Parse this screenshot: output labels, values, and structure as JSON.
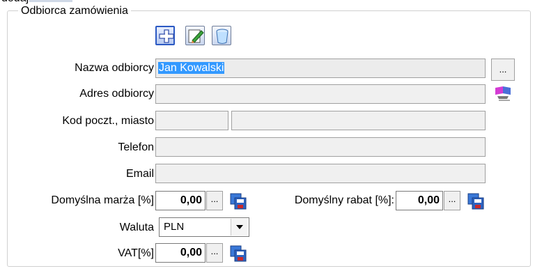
{
  "top_clipped_text": "dodaj",
  "group": {
    "title": "Odbiorca zamówienia"
  },
  "toolbar": {
    "add_icon": "plus-icon",
    "edit_icon": "pencil-icon",
    "delete_icon": "trash-icon"
  },
  "form": {
    "name_label": "Nazwa odbiorcy",
    "name_value": "Jan Kowalski",
    "name_browse_label": "...",
    "address_label": "Adres odbiorcy",
    "address_value": "",
    "address_button_icon": "address-book-icon",
    "postal_label": "Kod poczt., miasto",
    "postal_value": "",
    "city_value": "",
    "phone_label": "Telefon",
    "phone_value": "",
    "email_label": "Email",
    "email_value": "",
    "margin_label": "Domyślna marża [%]",
    "margin_value": "0,00",
    "margin_dots": "...",
    "discount_label": "Domyślny rabat [%]:",
    "discount_value": "0,00",
    "discount_dots": "...",
    "currency_label": "Waluta",
    "currency_value": "PLN",
    "vat_label": "VAT[%]",
    "vat_value": "0,00",
    "vat_dots": "..."
  }
}
